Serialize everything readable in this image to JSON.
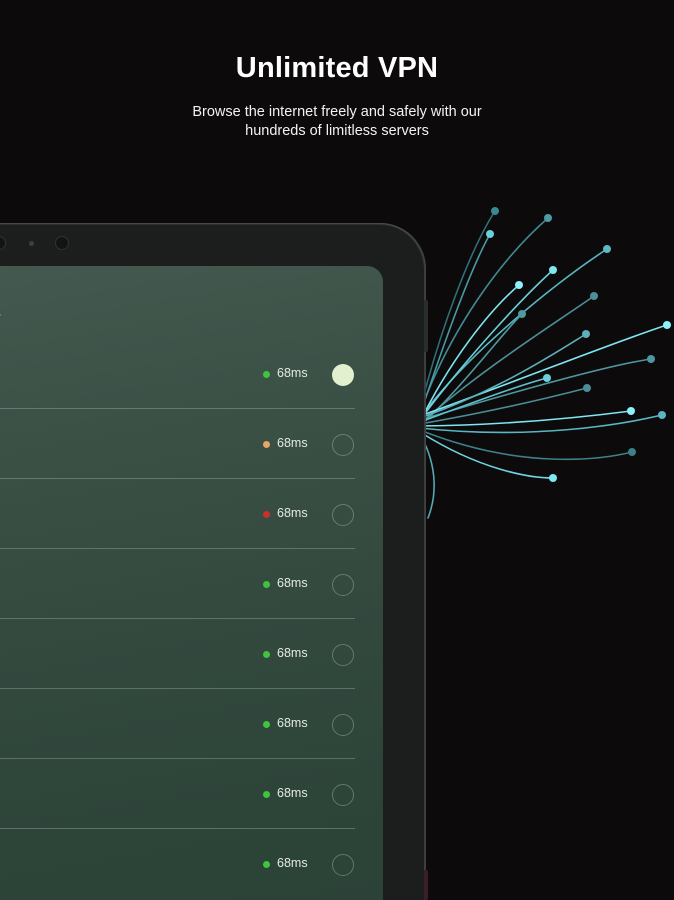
{
  "promo": {
    "title": "Unlimited VPN",
    "subtitle": "Browse the internet freely and safely with our hundreds of limitless servers"
  },
  "screen": {
    "title_fragment": "ver"
  },
  "colors": {
    "background": "#0c0a0a",
    "status_good": "#3ec43e",
    "status_medium": "#e8a56a",
    "status_bad": "#c8302a",
    "selected_radio": "#e3f0cf",
    "ray": "#7fe6f2"
  },
  "servers": [
    {
      "latency": "68ms",
      "status": "good",
      "selected": true
    },
    {
      "latency": "68ms",
      "status": "medium",
      "selected": false
    },
    {
      "latency": "68ms",
      "status": "bad",
      "selected": false
    },
    {
      "latency": "68ms",
      "status": "good",
      "selected": false
    },
    {
      "latency": "68ms",
      "status": "good",
      "selected": false
    },
    {
      "latency": "68ms",
      "status": "good",
      "selected": false
    },
    {
      "latency": "68ms",
      "status": "good",
      "selected": false
    },
    {
      "latency": "68ms",
      "status": "good",
      "selected": false
    }
  ]
}
